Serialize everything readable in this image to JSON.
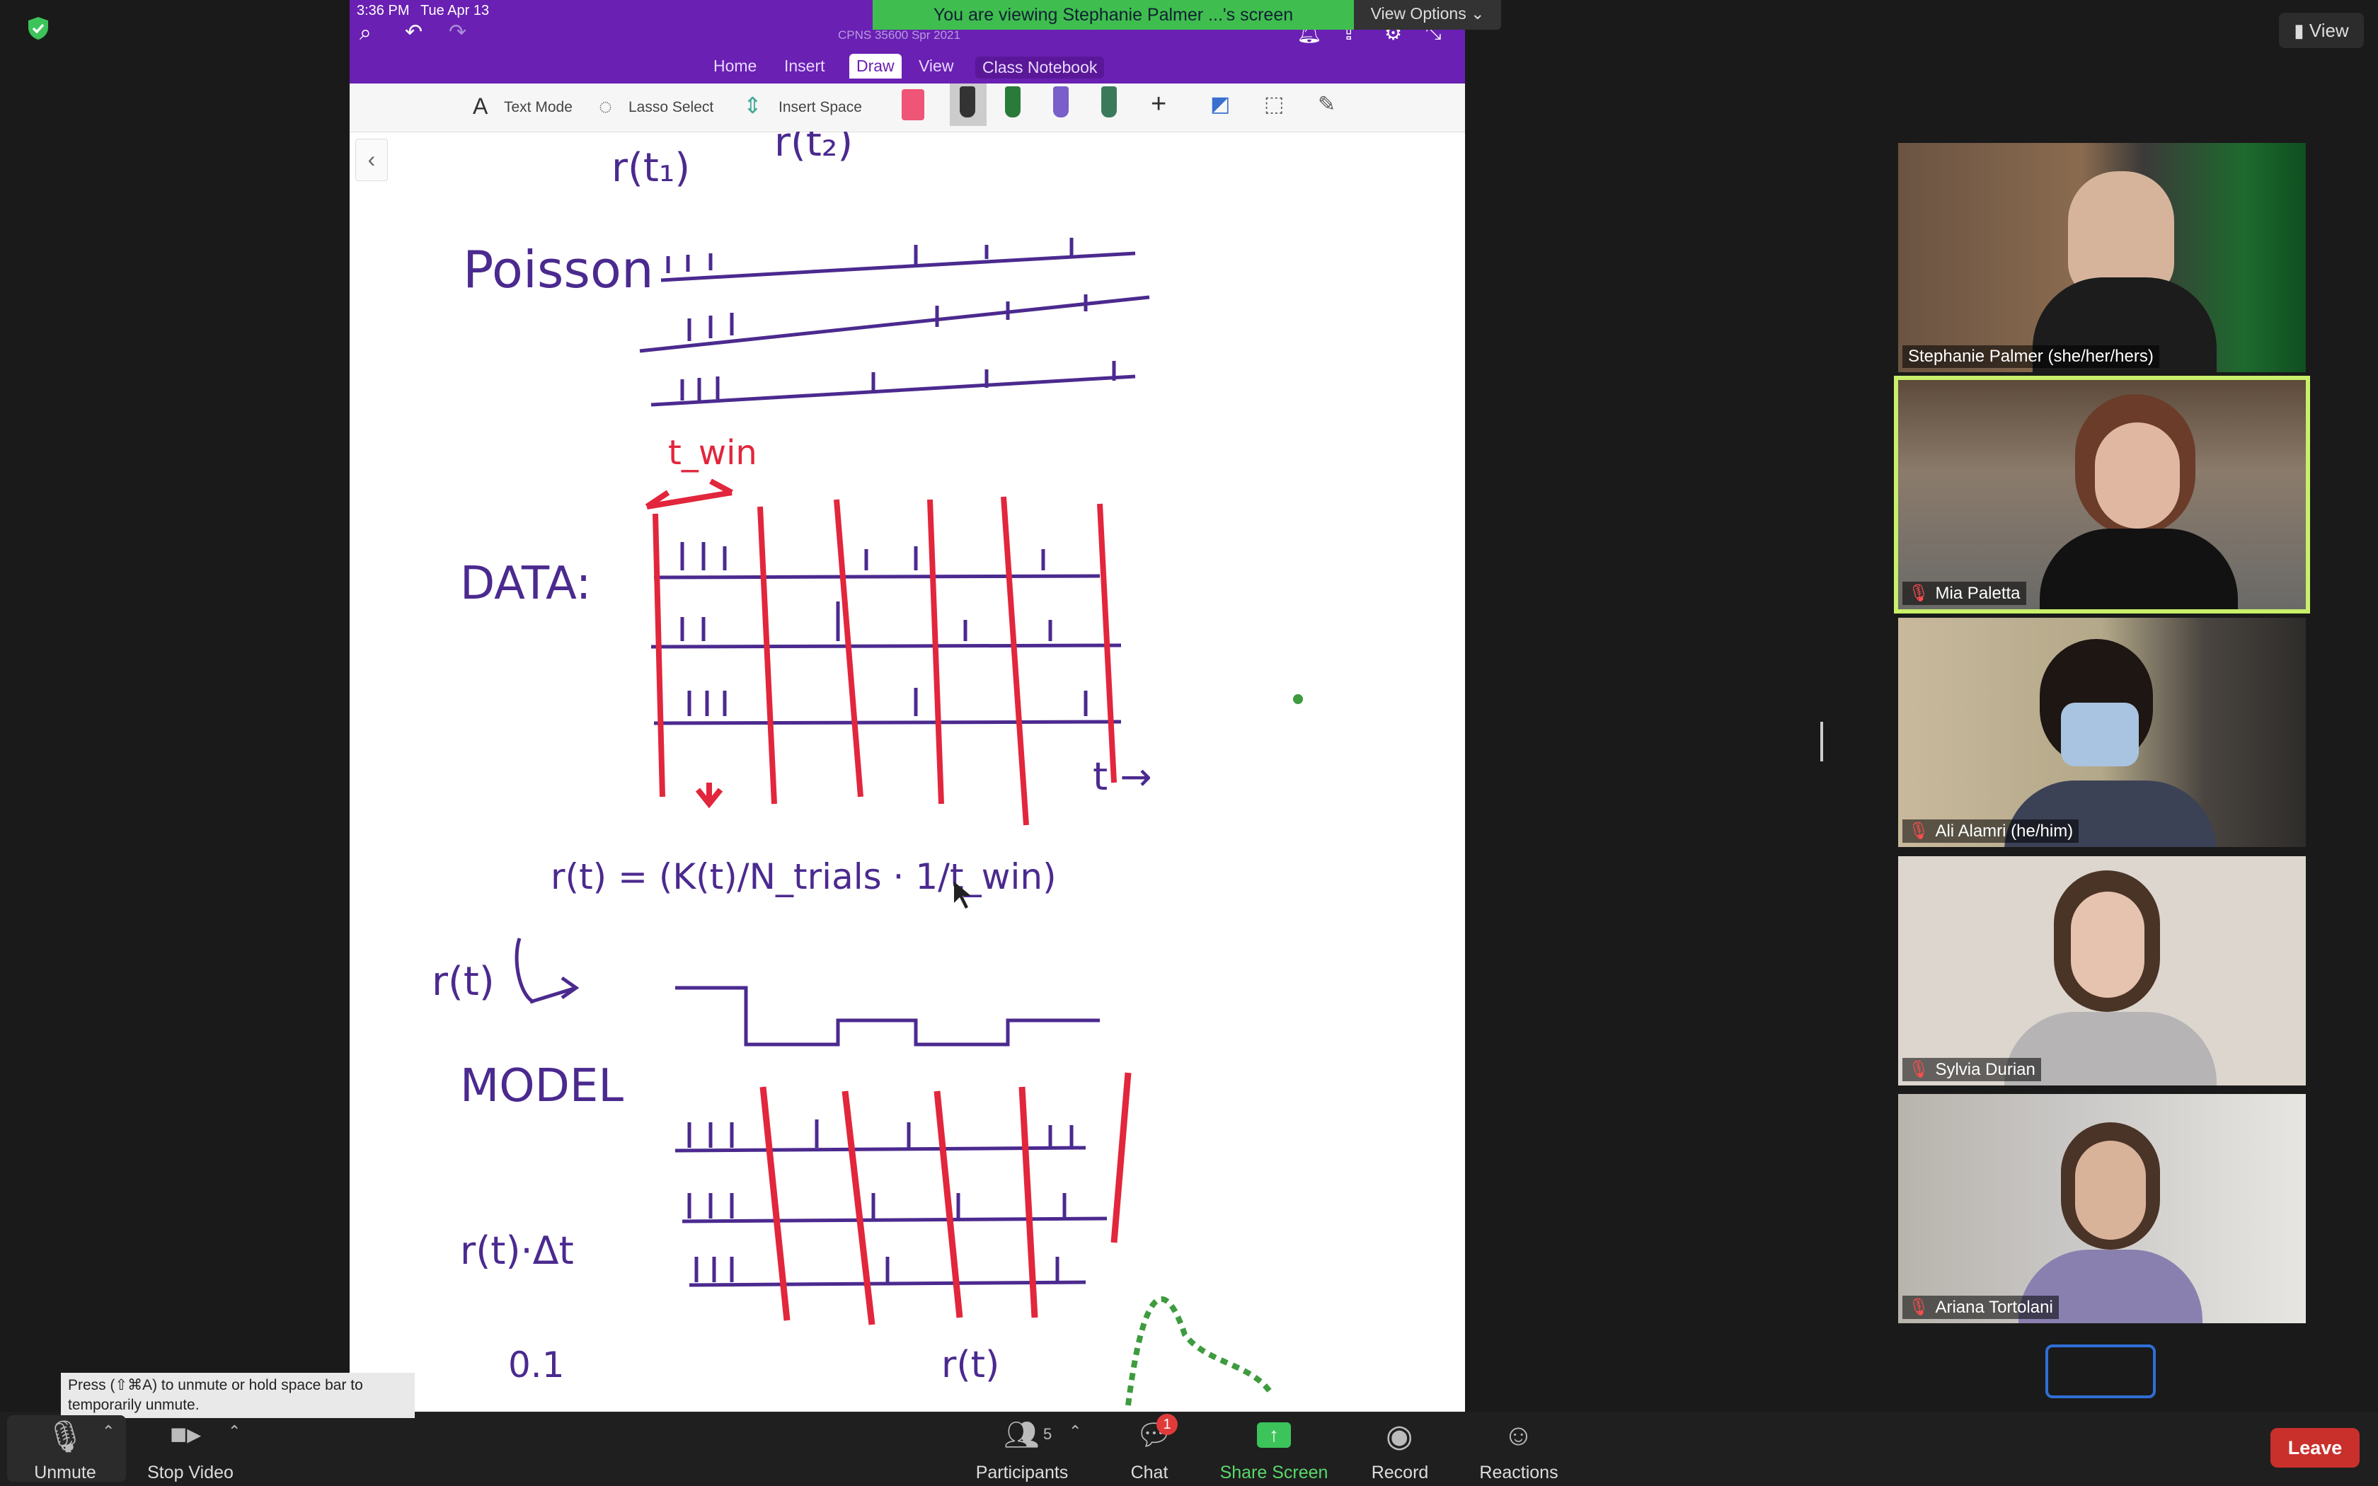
{
  "ipad": {
    "time": "3:36 PM",
    "date": "Tue Apr 13",
    "notebook_title": "CPNS 35600 Spr 2021",
    "tabs": [
      {
        "label": "Home"
      },
      {
        "label": "Insert"
      },
      {
        "label": "Draw"
      },
      {
        "label": "View"
      },
      {
        "label": "Class Notebook"
      }
    ],
    "toolbar": {
      "text_mode": "Text Mode",
      "lasso_select": "Lasso Select",
      "insert_space": "Insert Space"
    }
  },
  "banner": {
    "viewing_text": "You are viewing Stephanie Palmer ...'s screen",
    "view_options": "View Options"
  },
  "handwriting": {
    "r_t1": "r(t₁)",
    "r_t2": "r(t₂)",
    "poisson": "Poisson",
    "twin": "t_win",
    "data": "DATA:",
    "t_arrow": "t →",
    "rate_formula": "r(t) = (K(t)/N_trials · 1/t_win)",
    "r_t": "r(t)",
    "model": "MODEL",
    "r_dt": "r(t)·Δt",
    "point_one": "0.1",
    "r_t_plot": "r(t)"
  },
  "participants_panel": {
    "view_label": "View",
    "tiles": [
      {
        "name": "Stephanie Palmer (she/her/hers)",
        "muted": false,
        "bg": "#6b5442"
      },
      {
        "name": "Mia Paletta",
        "muted": true,
        "bg": "#5d4a3a"
      },
      {
        "name": "Ali Alamri (he/him)",
        "muted": true,
        "bg": "#6e6657"
      },
      {
        "name": "Sylvia Durian",
        "muted": true,
        "bg": "#c9c2b8"
      },
      {
        "name": "Ariana Tortolani",
        "muted": true,
        "bg": "#b8b4ad"
      }
    ]
  },
  "bottom_bar": {
    "unmute": "Unmute",
    "stop_video": "Stop Video",
    "participants": "Participants",
    "participants_count": "5",
    "chat": "Chat",
    "chat_badge": "1",
    "share_screen": "Share Screen",
    "record": "Record",
    "reactions": "Reactions",
    "leave": "Leave",
    "tooltip": "Press  (⇧⌘A) to unmute or hold space bar to temporarily unmute."
  }
}
